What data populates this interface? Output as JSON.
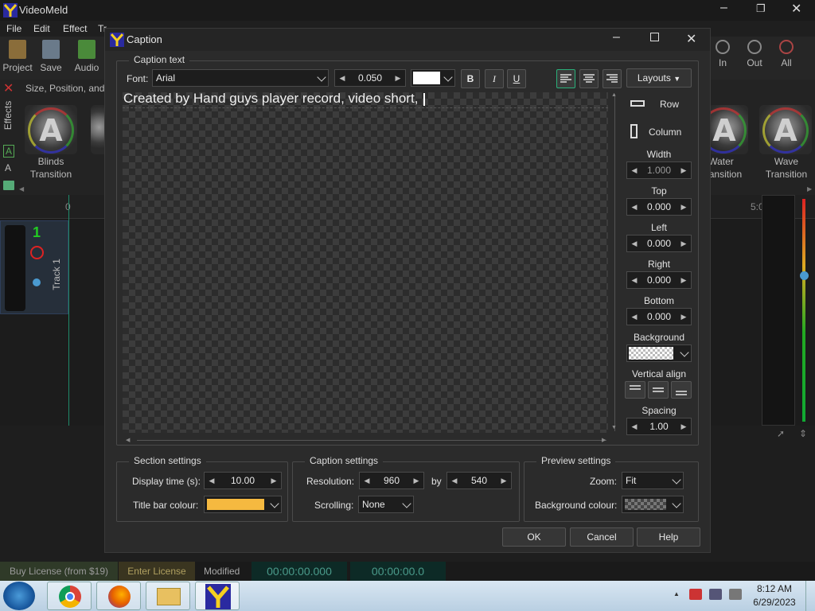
{
  "app": {
    "title": "VideoMeld",
    "menu": [
      "File",
      "Edit",
      "Effect",
      "Tr"
    ],
    "toolbar": {
      "project": "Project",
      "save": "Save",
      "audio": "Audio",
      "zoom_in": "In",
      "zoom_out": "Out",
      "zoom_all": "All"
    },
    "panel_title": "Size, Position, and",
    "effects_tab": "Effects",
    "effects": [
      {
        "label_line1": "Blinds",
        "label_line2": "Transition"
      },
      {
        "label_line1": "Water",
        "label_line2": "Transition"
      },
      {
        "label_line1": "Wave",
        "label_line2": "Transition"
      }
    ],
    "timeline": {
      "track_number": "1",
      "track_name": "Track 1",
      "ruler_start": "0",
      "ruler_end": "5:0"
    },
    "statusbar": {
      "buy": "Buy License (from $19)",
      "enter": "Enter License",
      "modified": "Modified",
      "time1": "00:00:00.000",
      "time2": "00:00:00.0"
    }
  },
  "dialog": {
    "title": "Caption",
    "caption_text_legend": "Caption text",
    "font_label": "Font:",
    "font_value": "Arial",
    "size_value": "0.050",
    "text_color": "#ffffff",
    "bold": "B",
    "italic": "I",
    "underline": "U",
    "layouts_label": "Layouts",
    "caption_text": "Created by Hand guys player record, video short, ",
    "right_panel": {
      "row": "Row",
      "column": "Column",
      "width_label": "Width",
      "width_value": "1.000",
      "top_label": "Top",
      "top_value": "0.000",
      "left_label": "Left",
      "left_value": "0.000",
      "right_label": "Right",
      "right_value": "0.000",
      "bottom_label": "Bottom",
      "bottom_value": "0.000",
      "background_label": "Background",
      "valign_label": "Vertical align",
      "spacing_label": "Spacing",
      "spacing_value": "1.00"
    },
    "section": {
      "legend": "Section settings",
      "display_time_label": "Display time (s):",
      "display_time": "10.00",
      "title_bar_label": "Title bar colour:",
      "title_bar_color": "#f5b940"
    },
    "caption_settings": {
      "legend": "Caption settings",
      "resolution_label": "Resolution:",
      "res_w": "960",
      "by": "by",
      "res_h": "540",
      "scrolling_label": "Scrolling:",
      "scrolling": "None"
    },
    "preview": {
      "legend": "Preview settings",
      "zoom_label": "Zoom:",
      "zoom": "Fit",
      "bg_label": "Background colour:"
    },
    "ok": "OK",
    "cancel": "Cancel",
    "help": "Help"
  },
  "taskbar": {
    "time": "8:12 AM",
    "date": "6/29/2023"
  }
}
